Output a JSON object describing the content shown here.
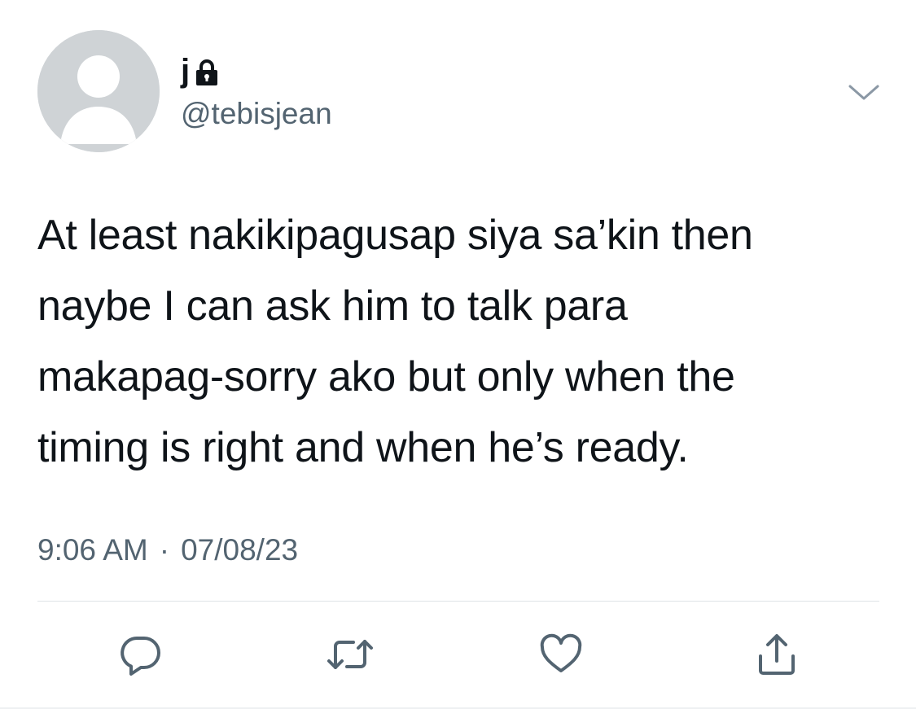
{
  "user": {
    "display_name": "j",
    "handle": "@tebisjean",
    "protected": true,
    "avatar": "default-avatar-icon"
  },
  "menu": {
    "icon": "chevron-down-icon"
  },
  "tweet": {
    "lines": [
      "At least nakikipagusap siya sa’kin then",
      "naybe I can ask him to talk para",
      "makapag-sorry ako but only when the",
      "timing is right and when he’s ready."
    ]
  },
  "meta": {
    "time": "9:06 AM",
    "separator": "·",
    "date": "07/08/23"
  },
  "actions": [
    {
      "name": "reply",
      "icon": "reply-icon"
    },
    {
      "name": "retweet",
      "icon": "retweet-icon"
    },
    {
      "name": "like",
      "icon": "heart-icon"
    },
    {
      "name": "share",
      "icon": "share-icon"
    }
  ],
  "colors": {
    "text": "#0f1419",
    "secondary": "#536471",
    "avatar_bg": "#cfd3d6",
    "divider": "#dfe3e6"
  }
}
